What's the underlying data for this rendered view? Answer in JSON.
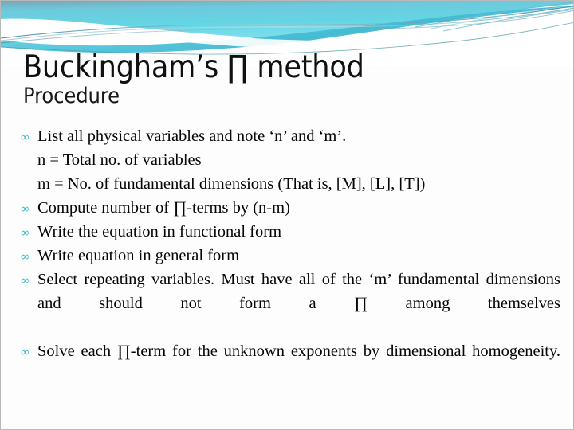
{
  "slide": {
    "title": "Buckingham’s ∏ method",
    "subtitle": "Procedure",
    "background_color": "#fdfdfd",
    "accent_color": "#3fb8c4",
    "header_gradient": {
      "top": "#6f9fb5",
      "mid": "#66d2e0",
      "bottom": "#8fe3ee"
    },
    "bullet_glyph": "∞"
  },
  "body": {
    "items": [
      {
        "bullet": true,
        "justified": false,
        "text": "List all physical variables and note ‘n’ and ‘m’."
      },
      {
        "bullet": false,
        "justified": false,
        "text": "n = Total no. of variables"
      },
      {
        "bullet": false,
        "justified": false,
        "text": "m = No. of fundamental dimensions (That is, [M], [L], [T])"
      },
      {
        "bullet": true,
        "justified": false,
        "text": "Compute number of ∏-terms by (n-m)"
      },
      {
        "bullet": true,
        "justified": false,
        "text": "Write the equation in functional form"
      },
      {
        "bullet": true,
        "justified": false,
        "text": "Write equation in general form"
      },
      {
        "bullet": true,
        "justified": true,
        "text": "Select repeating variables. Must have all of the ‘m’ fundamental dimensions and should not form a ∏ among themselves"
      },
      {
        "bullet": true,
        "justified": true,
        "text": "Solve each ∏-term for the unknown exponents by dimensional homogeneity."
      }
    ]
  }
}
